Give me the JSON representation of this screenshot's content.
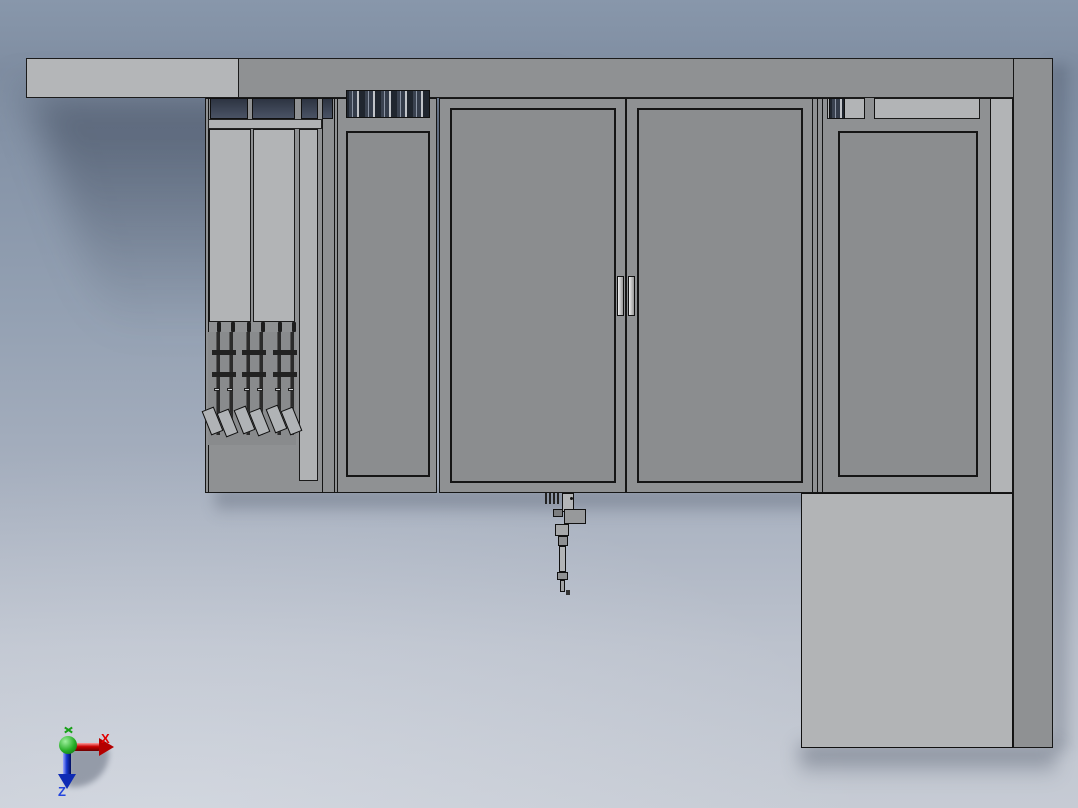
{
  "viewport": {
    "type": "cad-3d-viewport",
    "view_orientation": "front",
    "background_top_color": "#8897ab",
    "background_bottom_color": "#c6cbd4"
  },
  "model": {
    "name": "machine enclosure assembly",
    "frame_color": "#8f9193",
    "panel_color": "#8b8d8f",
    "light_panel_color": "#b2b4b6",
    "window_color": "#333b49",
    "parts": [
      "top-beam",
      "left-cabinet",
      "feeder-mechanism",
      "inner-cabinet-door",
      "double-doors",
      "right-cabinet",
      "right-column",
      "lower-right-cabinet",
      "dispenser-head"
    ]
  },
  "triad": {
    "x_label": "X",
    "z_label": "Z",
    "x_color": "#cc0000",
    "y_color": "#22aa22",
    "z_color": "#2244cc",
    "origin_color": "#27ad27"
  }
}
